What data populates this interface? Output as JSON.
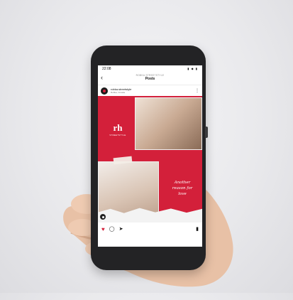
{
  "status": {
    "time": "22:08",
    "icons": "▮ ◆ ▮"
  },
  "nav": {
    "subtitle": "ROBKA STREETSTYLE",
    "title": "Posts",
    "back": "‹"
  },
  "post": {
    "username": "robka.streetstyle",
    "location": "Robka, Croatia",
    "more": "⋮",
    "logo_mark": "rh",
    "logo_text": "STREETSTYLE",
    "caption_line1": "Another",
    "caption_line2": "reason for",
    "caption_line3": "love"
  },
  "actions": {
    "like": "♥",
    "comment": "◯",
    "share": "➤",
    "save": "▮"
  },
  "colors": {
    "brand_red": "#d3203a",
    "phone_body": "#232325",
    "background": "#ececee"
  }
}
